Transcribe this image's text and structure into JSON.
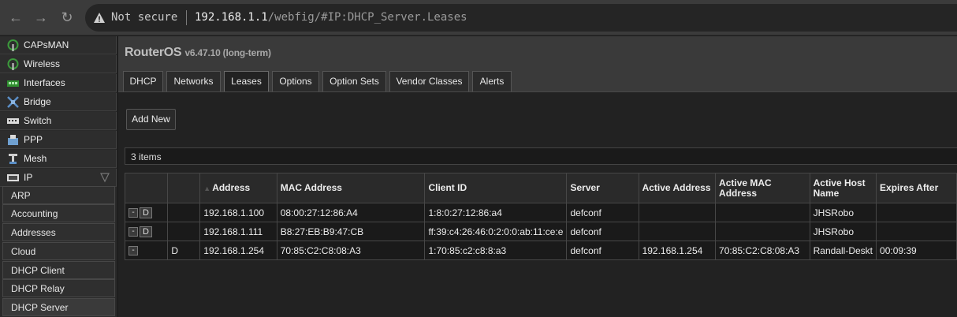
{
  "browser": {
    "back_icon": "arrow-left-icon",
    "forward_icon": "arrow-right-icon",
    "reload_icon": "reload-icon",
    "security_label": "Not secure",
    "url_host": "192.168.1.1",
    "url_path": "/webfig/#IP:DHCP_Server.Leases"
  },
  "sidebar": {
    "items": [
      {
        "label": "CAPsMAN",
        "icon": "antenna-icon"
      },
      {
        "label": "Wireless",
        "icon": "antenna-icon"
      },
      {
        "label": "Interfaces",
        "icon": "interfaces-icon"
      },
      {
        "label": "Bridge",
        "icon": "bridge-icon"
      },
      {
        "label": "Switch",
        "icon": "switch-icon"
      },
      {
        "label": "PPP",
        "icon": "ppp-icon"
      },
      {
        "label": "Mesh",
        "icon": "mesh-icon"
      },
      {
        "label": "IP",
        "icon": "ip-icon"
      }
    ],
    "ip_submenu": [
      "ARP",
      "Accounting",
      "Addresses",
      "Cloud",
      "DHCP Client",
      "DHCP Relay",
      "DHCP Server"
    ]
  },
  "header": {
    "product": "RouterOS",
    "version": "v6.47.10 (long-term)"
  },
  "tabs": [
    "DHCP",
    "Networks",
    "Leases",
    "Options",
    "Option Sets",
    "Vendor Classes",
    "Alerts"
  ],
  "active_tab": "Leases",
  "toolbar": {
    "add_label": "Add New"
  },
  "list": {
    "count_label": "3 items",
    "columns": [
      "",
      "",
      "Address",
      "MAC Address",
      "Client ID",
      "Server",
      "Active Address",
      "Active MAC Address",
      "Active Host Name",
      "Expires After"
    ],
    "rows": [
      {
        "flag": "",
        "address": "192.168.1.100",
        "mac": "08:00:27:12:86:A4",
        "client_id": "1:8:0:27:12:86:a4",
        "server": "defconf",
        "active_address": "",
        "active_mac": "",
        "host": "JHSRobo",
        "expires": ""
      },
      {
        "flag": "",
        "address": "192.168.1.111",
        "mac": "B8:27:EB:B9:47:CB",
        "client_id": "ff:39:c4:26:46:0:2:0:0:ab:11:ce:e",
        "server": "defconf",
        "active_address": "",
        "active_mac": "",
        "host": "JHSRobo",
        "expires": ""
      },
      {
        "flag": "D",
        "address": "192.168.1.254",
        "mac": "70:85:C2:C8:08:A3",
        "client_id": "1:70:85:c2:c8:8:a3",
        "server": "defconf",
        "active_address": "192.168.1.254",
        "active_mac": "70:85:C2:C8:08:A3",
        "host": "Randall-Deskt",
        "expires": "00:09:39"
      }
    ],
    "remove_label": "-",
    "disable_label": "D"
  }
}
